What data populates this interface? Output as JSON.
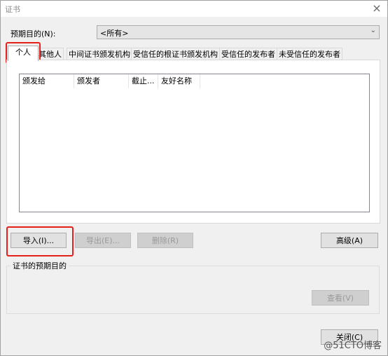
{
  "window": {
    "title": "证书",
    "close_symbol": "×"
  },
  "purpose": {
    "label": "预期目的(N):",
    "value": "<所有>"
  },
  "tabs": [
    {
      "label": "个人"
    },
    {
      "label": "其他人"
    },
    {
      "label": "中间证书颁发机构"
    },
    {
      "label": "受信任的根证书颁发机构"
    },
    {
      "label": "受信任的发布者"
    },
    {
      "label": "未受信任的发布者"
    }
  ],
  "columns": [
    {
      "label": "颁发给"
    },
    {
      "label": "颁发者"
    },
    {
      "label": "截止..."
    },
    {
      "label": "友好名称"
    }
  ],
  "buttons": {
    "import": "导入(I)...",
    "export": "导出(E)...",
    "delete": "删除(R)",
    "advanced": "高级(A)",
    "view": "查看(V)",
    "close": "关闭(C)"
  },
  "purposes_group": {
    "label": "证书的预期目的"
  },
  "watermark": "@51CTO博客",
  "colors": {
    "highlight": "#e5211a",
    "dialog_bg": "#f0f0f0"
  }
}
